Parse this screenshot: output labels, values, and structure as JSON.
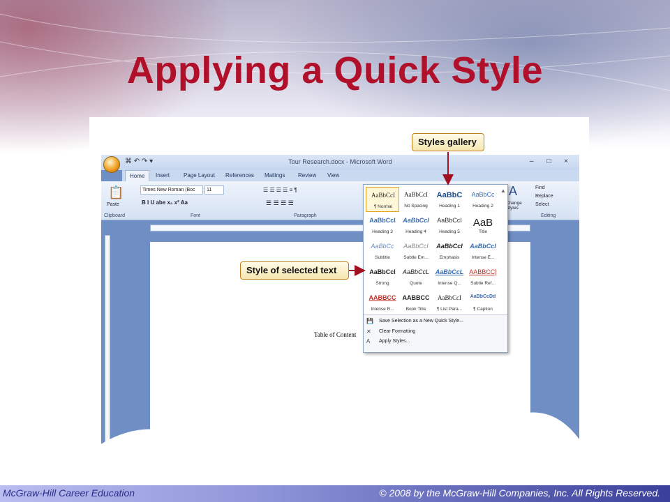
{
  "slide": {
    "title": "Applying a Quick Style",
    "footer_left": "McGraw-Hill Career Education",
    "footer_right": "© 2008 by the McGraw-Hill Companies, Inc.  All Rights Reserved.",
    "title_color": "#b0102a"
  },
  "word": {
    "window_title": "Tour Research.docx - Microsoft Word",
    "qat": "⌘ ↶ ↷ ▾",
    "win_controls": "– □ ×",
    "tabs": [
      "Home",
      "Insert",
      "Page Layout",
      "References",
      "Mailings",
      "Review",
      "View"
    ],
    "ribbon": {
      "paste_label": "Paste",
      "font_name": "Times New Roman (Boc",
      "font_size": "11",
      "groups": [
        "Clipboard",
        "Font",
        "Paragraph",
        "Editing"
      ],
      "format_buttons": "B  I  U  abe  x₂  x²  Aa",
      "para_buttons": "☰ ☰ ☰ ☰  ≡  ¶",
      "find_label": "Find",
      "replace_label": "Replace",
      "select_label": "Select",
      "change_styles_label": "Change Styles"
    },
    "document_text": "Table of Content"
  },
  "styles_gallery": {
    "items": [
      {
        "sample": "AaBbCcI",
        "name": "¶ Normal"
      },
      {
        "sample": "AaBbCcI",
        "name": "No Spacing"
      },
      {
        "sample": "AaBbC",
        "name": "Heading 1"
      },
      {
        "sample": "AaBbCc",
        "name": "Heading 2"
      },
      {
        "sample": "AaBbCcI",
        "name": "Heading 3"
      },
      {
        "sample": "AaBbCcI",
        "name": "Heading 4"
      },
      {
        "sample": "AaBbCcI",
        "name": "Heading 5"
      },
      {
        "sample": "AaB",
        "name": "Title"
      },
      {
        "sample": "AaBbCc",
        "name": "Subtitle"
      },
      {
        "sample": "AaBbCcI",
        "name": "Subtle Em..."
      },
      {
        "sample": "AaBbCcI",
        "name": "Emphasis"
      },
      {
        "sample": "AaBbCcI",
        "name": "Intense E..."
      },
      {
        "sample": "AaBbCcl",
        "name": "Strong"
      },
      {
        "sample": "AaBbCcL",
        "name": "Quote"
      },
      {
        "sample": "AaBbCcL",
        "name": "Intense Q..."
      },
      {
        "sample": "AABBCC]",
        "name": "Subtle Ref..."
      },
      {
        "sample": "AABBCC",
        "name": "Intense R..."
      },
      {
        "sample": "AABBCC",
        "name": "Book Title"
      },
      {
        "sample": "AaBbCcI",
        "name": "¶ List Para..."
      },
      {
        "sample": "AaBbCcDd",
        "name": "¶ Caption"
      }
    ],
    "menu": [
      "Save Selection as a New Quick Style...",
      "Clear Formatting",
      "Apply Styles..."
    ],
    "selected_index": 0
  },
  "callouts": {
    "styles_gallery": "Styles gallery",
    "selected_text": "Style of selected text"
  },
  "colors": {
    "callout_border": "#c08020",
    "arrow": "#a01020",
    "word_frame": "#6f8fc4"
  }
}
